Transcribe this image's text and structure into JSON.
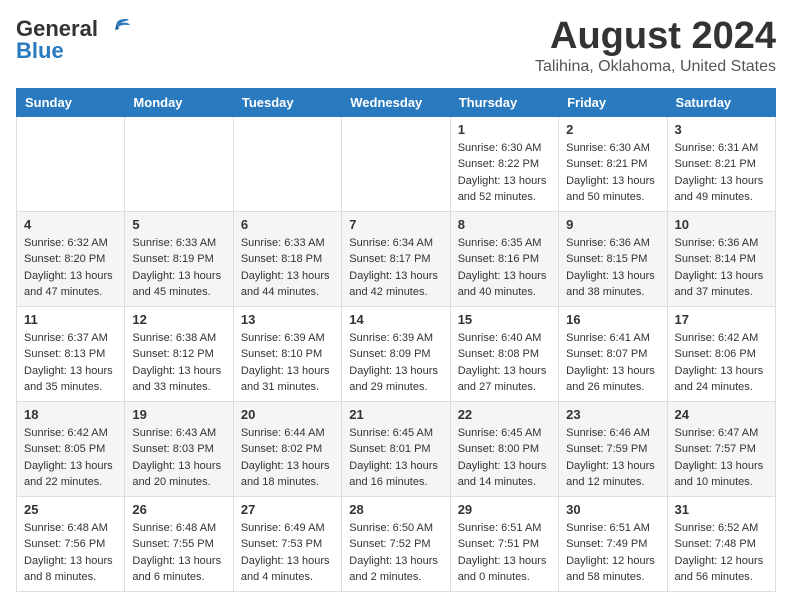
{
  "logo": {
    "line1": "General",
    "line2": "Blue"
  },
  "title": "August 2024",
  "subtitle": "Talihina, Oklahoma, United States",
  "weekdays": [
    "Sunday",
    "Monday",
    "Tuesday",
    "Wednesday",
    "Thursday",
    "Friday",
    "Saturday"
  ],
  "weeks": [
    [
      {
        "day": "",
        "info": ""
      },
      {
        "day": "",
        "info": ""
      },
      {
        "day": "",
        "info": ""
      },
      {
        "day": "",
        "info": ""
      },
      {
        "day": "1",
        "info": "Sunrise: 6:30 AM\nSunset: 8:22 PM\nDaylight: 13 hours\nand 52 minutes."
      },
      {
        "day": "2",
        "info": "Sunrise: 6:30 AM\nSunset: 8:21 PM\nDaylight: 13 hours\nand 50 minutes."
      },
      {
        "day": "3",
        "info": "Sunrise: 6:31 AM\nSunset: 8:21 PM\nDaylight: 13 hours\nand 49 minutes."
      }
    ],
    [
      {
        "day": "4",
        "info": "Sunrise: 6:32 AM\nSunset: 8:20 PM\nDaylight: 13 hours\nand 47 minutes."
      },
      {
        "day": "5",
        "info": "Sunrise: 6:33 AM\nSunset: 8:19 PM\nDaylight: 13 hours\nand 45 minutes."
      },
      {
        "day": "6",
        "info": "Sunrise: 6:33 AM\nSunset: 8:18 PM\nDaylight: 13 hours\nand 44 minutes."
      },
      {
        "day": "7",
        "info": "Sunrise: 6:34 AM\nSunset: 8:17 PM\nDaylight: 13 hours\nand 42 minutes."
      },
      {
        "day": "8",
        "info": "Sunrise: 6:35 AM\nSunset: 8:16 PM\nDaylight: 13 hours\nand 40 minutes."
      },
      {
        "day": "9",
        "info": "Sunrise: 6:36 AM\nSunset: 8:15 PM\nDaylight: 13 hours\nand 38 minutes."
      },
      {
        "day": "10",
        "info": "Sunrise: 6:36 AM\nSunset: 8:14 PM\nDaylight: 13 hours\nand 37 minutes."
      }
    ],
    [
      {
        "day": "11",
        "info": "Sunrise: 6:37 AM\nSunset: 8:13 PM\nDaylight: 13 hours\nand 35 minutes."
      },
      {
        "day": "12",
        "info": "Sunrise: 6:38 AM\nSunset: 8:12 PM\nDaylight: 13 hours\nand 33 minutes."
      },
      {
        "day": "13",
        "info": "Sunrise: 6:39 AM\nSunset: 8:10 PM\nDaylight: 13 hours\nand 31 minutes."
      },
      {
        "day": "14",
        "info": "Sunrise: 6:39 AM\nSunset: 8:09 PM\nDaylight: 13 hours\nand 29 minutes."
      },
      {
        "day": "15",
        "info": "Sunrise: 6:40 AM\nSunset: 8:08 PM\nDaylight: 13 hours\nand 27 minutes."
      },
      {
        "day": "16",
        "info": "Sunrise: 6:41 AM\nSunset: 8:07 PM\nDaylight: 13 hours\nand 26 minutes."
      },
      {
        "day": "17",
        "info": "Sunrise: 6:42 AM\nSunset: 8:06 PM\nDaylight: 13 hours\nand 24 minutes."
      }
    ],
    [
      {
        "day": "18",
        "info": "Sunrise: 6:42 AM\nSunset: 8:05 PM\nDaylight: 13 hours\nand 22 minutes."
      },
      {
        "day": "19",
        "info": "Sunrise: 6:43 AM\nSunset: 8:03 PM\nDaylight: 13 hours\nand 20 minutes."
      },
      {
        "day": "20",
        "info": "Sunrise: 6:44 AM\nSunset: 8:02 PM\nDaylight: 13 hours\nand 18 minutes."
      },
      {
        "day": "21",
        "info": "Sunrise: 6:45 AM\nSunset: 8:01 PM\nDaylight: 13 hours\nand 16 minutes."
      },
      {
        "day": "22",
        "info": "Sunrise: 6:45 AM\nSunset: 8:00 PM\nDaylight: 13 hours\nand 14 minutes."
      },
      {
        "day": "23",
        "info": "Sunrise: 6:46 AM\nSunset: 7:59 PM\nDaylight: 13 hours\nand 12 minutes."
      },
      {
        "day": "24",
        "info": "Sunrise: 6:47 AM\nSunset: 7:57 PM\nDaylight: 13 hours\nand 10 minutes."
      }
    ],
    [
      {
        "day": "25",
        "info": "Sunrise: 6:48 AM\nSunset: 7:56 PM\nDaylight: 13 hours\nand 8 minutes."
      },
      {
        "day": "26",
        "info": "Sunrise: 6:48 AM\nSunset: 7:55 PM\nDaylight: 13 hours\nand 6 minutes."
      },
      {
        "day": "27",
        "info": "Sunrise: 6:49 AM\nSunset: 7:53 PM\nDaylight: 13 hours\nand 4 minutes."
      },
      {
        "day": "28",
        "info": "Sunrise: 6:50 AM\nSunset: 7:52 PM\nDaylight: 13 hours\nand 2 minutes."
      },
      {
        "day": "29",
        "info": "Sunrise: 6:51 AM\nSunset: 7:51 PM\nDaylight: 13 hours\nand 0 minutes."
      },
      {
        "day": "30",
        "info": "Sunrise: 6:51 AM\nSunset: 7:49 PM\nDaylight: 12 hours\nand 58 minutes."
      },
      {
        "day": "31",
        "info": "Sunrise: 6:52 AM\nSunset: 7:48 PM\nDaylight: 12 hours\nand 56 minutes."
      }
    ]
  ]
}
